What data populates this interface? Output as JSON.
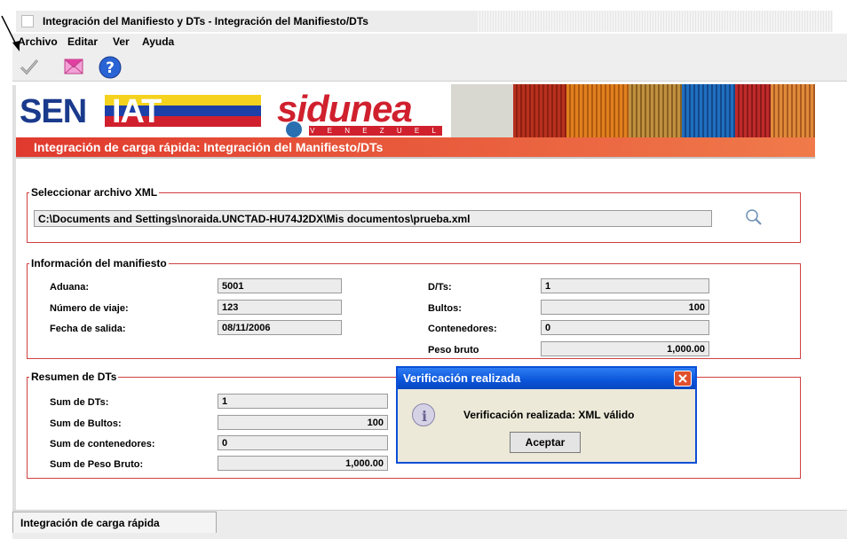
{
  "window": {
    "title": "Integración del Manifiesto y DTs - Integración del Manifiesto/DTs"
  },
  "menu": {
    "items": [
      "Archivo",
      "Editar",
      "Ver",
      "Ayuda"
    ]
  },
  "toolbar": {
    "icons": [
      "checkmark-icon",
      "envelope-icon",
      "help-icon"
    ]
  },
  "banner": {
    "brand_left": "SEN",
    "brand_right_part": "IAT",
    "product": "sidunea",
    "product_subtitle": "V E N E Z U E L A",
    "subheader": "Integración de carga rápida: Integración del Manifiesto/DTs"
  },
  "xml_section": {
    "legend": "Seleccionar archivo XML",
    "file_path": "C:\\Documents and Settings\\noraida.UNCTAD-HU74J2DX\\Mis documentos\\prueba.xml"
  },
  "manifest": {
    "legend": "Información del manifiesto",
    "aduana_label": "Aduana:",
    "aduana_value": "5001",
    "viaje_label": "Número de viaje:",
    "viaje_value": "123",
    "fecha_label": "Fecha de salida:",
    "fecha_value": "08/11/2006",
    "dts_label": "D/Ts:",
    "dts_value": "1",
    "bultos_label": "Bultos:",
    "bultos_value": "100",
    "contenedores_label": "Contenedores:",
    "contenedores_value": "0",
    "peso_label": "Peso bruto",
    "peso_value": "1,000.00"
  },
  "summary": {
    "legend": "Resumen de DTs",
    "sum_dts_label": "Sum de DTs:",
    "sum_dts_value": "1",
    "sum_bultos_label": "Sum de Bultos:",
    "sum_bultos_value": "100",
    "sum_cont_label": "Sum de contenedores:",
    "sum_cont_value": "0",
    "sum_peso_label": "Sum de Peso Bruto:",
    "sum_peso_value": "1,000.00"
  },
  "dialog": {
    "title": "Verificación realizada",
    "message": "Verificación realizada: XML válido",
    "button": "Aceptar"
  },
  "bottom_tab": {
    "label": "Integración de carga rápida"
  },
  "colors": {
    "accent_red": "#d0202e",
    "dialog_blue": "#0a54d8",
    "brand_blue": "#1a3a8c"
  }
}
